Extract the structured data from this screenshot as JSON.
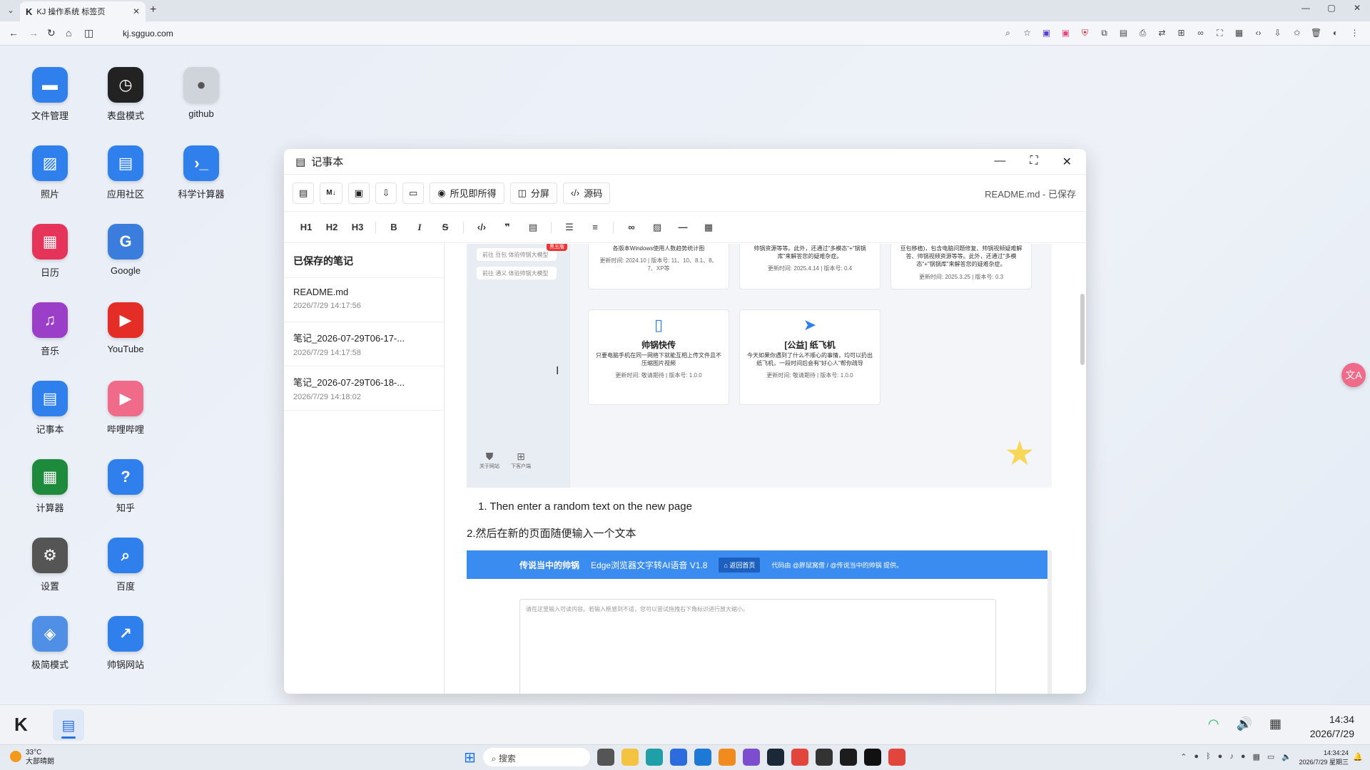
{
  "browser": {
    "tab_title": "KJ 操作系统 标签页",
    "url": "kj.sgguo.com"
  },
  "desktop_apps": [
    {
      "label": "文件管理",
      "icon": "folder-icon",
      "color": "#2f80ed"
    },
    {
      "label": "表盘模式",
      "icon": "clock-icon",
      "color": "#222222"
    },
    {
      "label": "github",
      "icon": "github-icon",
      "color": "#cfd3da"
    },
    {
      "label": "照片",
      "icon": "photo-icon",
      "color": "#2f80ed"
    },
    {
      "label": "应用社区",
      "icon": "store-icon",
      "color": "#2f80ed"
    },
    {
      "label": "科学计算器",
      "icon": "terminal-icon",
      "color": "#2f80ed"
    },
    {
      "label": "日历",
      "icon": "calendar-icon",
      "color": "#e6335a"
    },
    {
      "label": "Google",
      "icon": "google-icon",
      "color": "#3b7ddd"
    },
    {
      "label": "音乐",
      "icon": "music-icon",
      "color": "#9b3fc9"
    },
    {
      "label": "YouTube",
      "icon": "youtube-icon",
      "color": "#e52d27"
    },
    {
      "label": "记事本",
      "icon": "notepad-icon",
      "color": "#2f80ed"
    },
    {
      "label": "哔哩哔哩",
      "icon": "bilibili-icon",
      "color": "#f06a8a"
    },
    {
      "label": "计算器",
      "icon": "calculator-icon",
      "color": "#1e8a3c"
    },
    {
      "label": "知乎",
      "icon": "zhihu-icon",
      "color": "#2f80ed"
    },
    {
      "label": "设置",
      "icon": "gear-icon",
      "color": "#555555"
    },
    {
      "label": "百度",
      "icon": "search-icon",
      "color": "#2f80ed"
    },
    {
      "label": "极简模式",
      "icon": "cube-icon",
      "color": "#4f8fe6"
    },
    {
      "label": "帅锅网站",
      "icon": "external-link-icon",
      "color": "#2f80ed"
    }
  ],
  "notepad": {
    "title": "记事本",
    "status": "README.md - 已保存",
    "mode_buttons": {
      "wysiwyg": "所见即所得",
      "split": "分屏",
      "source": "源码"
    },
    "format_buttons": {
      "h1": "H1",
      "h2": "H2",
      "h3": "H3"
    },
    "sidebar_title": "已保存的笔记",
    "notes": [
      {
        "name": "README.md",
        "date": "2026/7/29 14:17:56"
      },
      {
        "name": "笔记_2026-07-29T06-17-...",
        "date": "2026/7/29 14:17:58"
      },
      {
        "name": "笔记_2026-07-29T06-18-...",
        "date": "2026/7/29 14:18:02"
      }
    ],
    "content": {
      "chips": [
        "前往 豆包 体验帅锅大模型",
        "前往 通义 体验帅锅大模型"
      ],
      "hot_tag": "黑五版",
      "cards_top": [
        {
          "text": "各版本Windows使用人数趋势统计图",
          "meta": "更新时间: 2024.10 | 版本号: 11、10、8.1、8、7、XP等"
        },
        {
          "text": "帅锅资源等等。此外，还通过\"多模态\"+\"锅锅库\"来解答您的疑难杂症。",
          "meta": "更新时间: 2025.4.14 | 版本号: 0.4"
        },
        {
          "text": "豆包移植)，包含电脑问题修复、帅锅视频疑难解答、帅锅视频资源等等。此外，还通过\"多模态\"+\"锅锅库\"来解答您的疑难杂症。",
          "meta": "更新时间: 2025.3.25 | 版本号: 0.3"
        }
      ],
      "cards_bottom": [
        {
          "title": "帅锅快传",
          "text": "只要电脑手机在同一网络下就能互相上传文件且不压缩图片视频",
          "meta": "更新时间: 敬请期待 | 版本号: 1.0.0"
        },
        {
          "title": "[公益] 纸飞机",
          "text": "今天如果你遇到了什么不顺心的事情，均可以扔出纸飞机，一段时间后会有\"好心人\"帮你疏导",
          "meta": "更新时间: 敬请期待 | 版本号: 1.0.0"
        }
      ],
      "mini_links": [
        "关于网站",
        "下客户端"
      ],
      "line1": "1. Then enter a random text on the new page",
      "line2": "2.然后在新的页面随便输入一个文本",
      "banner_author": "传说当中的帅锅",
      "banner_title": "Edge浏览器文字转AI语音 V1.8",
      "banner_home": "返回首页",
      "banner_credit": "代码由 @胖鼠窝僧 / @传说当中的帅锅 提供。",
      "textarea_placeholder": "请在这里输入可读内容。若输入框感到不适，您可以尝试拖拽右下角标识进行放大缩小。"
    }
  },
  "taskbar": {
    "time": "14:34",
    "date": "2026/7/29"
  },
  "windows_taskbar": {
    "temp": "33°C",
    "weather": "大部晴朗",
    "search": "搜索",
    "time": "14:34:24",
    "date": "2026/7/29 星期三"
  }
}
